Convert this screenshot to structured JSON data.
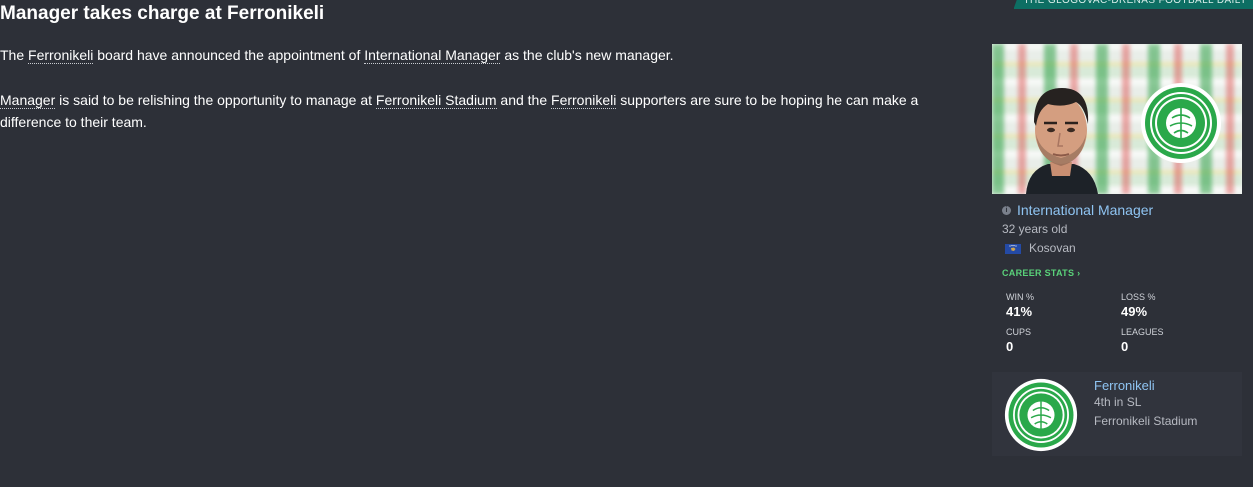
{
  "headline": "Manager takes charge at Ferronikeli",
  "newspaper": "THE GLOGOVAC-DRENAS FOOTBALL DAILY",
  "article": {
    "p1": {
      "t1": "The ",
      "link_club": "Ferronikeli",
      "t2": " board have announced the appointment of ",
      "link_manager": "International Manager",
      "t3": " as the club's new manager."
    },
    "p2": {
      "link_manager": "Manager",
      "t1": " is said to be relishing the opportunity to manage at ",
      "link_stadium": "Ferronikeli Stadium",
      "t2": " and the ",
      "link_club": "Ferronikeli",
      "t3": " supporters are sure to be hoping he can make a difference to their team."
    }
  },
  "manager": {
    "name": "International Manager",
    "age": "32 years old",
    "nationality": "Kosovan"
  },
  "career_stats": {
    "heading": "CAREER STATS",
    "win_label": "WIN %",
    "win_value": "41%",
    "loss_label": "LOSS %",
    "loss_value": "49%",
    "cups_label": "CUPS",
    "cups_value": "0",
    "leagues_label": "LEAGUES",
    "leagues_value": "0"
  },
  "club": {
    "name": "Ferronikeli",
    "position": "4th in SL",
    "stadium": "Ferronikeli Stadium"
  },
  "colors": {
    "background": "#2d3038",
    "link_blue": "#8fc4f2",
    "accent_green": "#5ad27a",
    "badge_green": "#2aa84a",
    "tag_teal": "#0d6e63"
  }
}
